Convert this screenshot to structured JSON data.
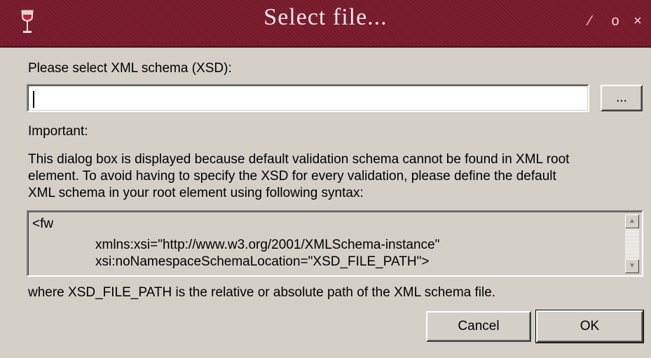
{
  "window": {
    "title": "Select file...",
    "controls": {
      "minimize": "⁄",
      "maximize": "o",
      "close": "×"
    }
  },
  "form": {
    "schema_label": "Please select XML schema (XSD):",
    "schema_value": "",
    "browse_label": "...",
    "important_label": "Important:",
    "description_lines": [
      "This dialog box is displayed because default validation schema cannot be found in XML root",
      "element. To avoid having to specify the XSD for every validation, please define the default",
      "XML schema in your root element using following syntax:"
    ],
    "code_lines": [
      "<fw",
      "xmlns:xsi=\"http://www.w3.org/2001/XMLSchema-instance\"",
      "xsi:noNamespaceSchemaLocation=\"XSD_FILE_PATH\">"
    ],
    "footnote": "where XSD_FILE_PATH is the relative or absolute path of the XML schema file."
  },
  "buttons": {
    "cancel": "Cancel",
    "ok": "OK"
  },
  "scrollbar": {
    "up_arrow": "▲",
    "down_arrow": "▼"
  },
  "colors": {
    "titlebar": "#7b1a2c",
    "dialog_bg": "#d4d0c8"
  },
  "icons": {
    "app": "wine-glass-icon"
  }
}
